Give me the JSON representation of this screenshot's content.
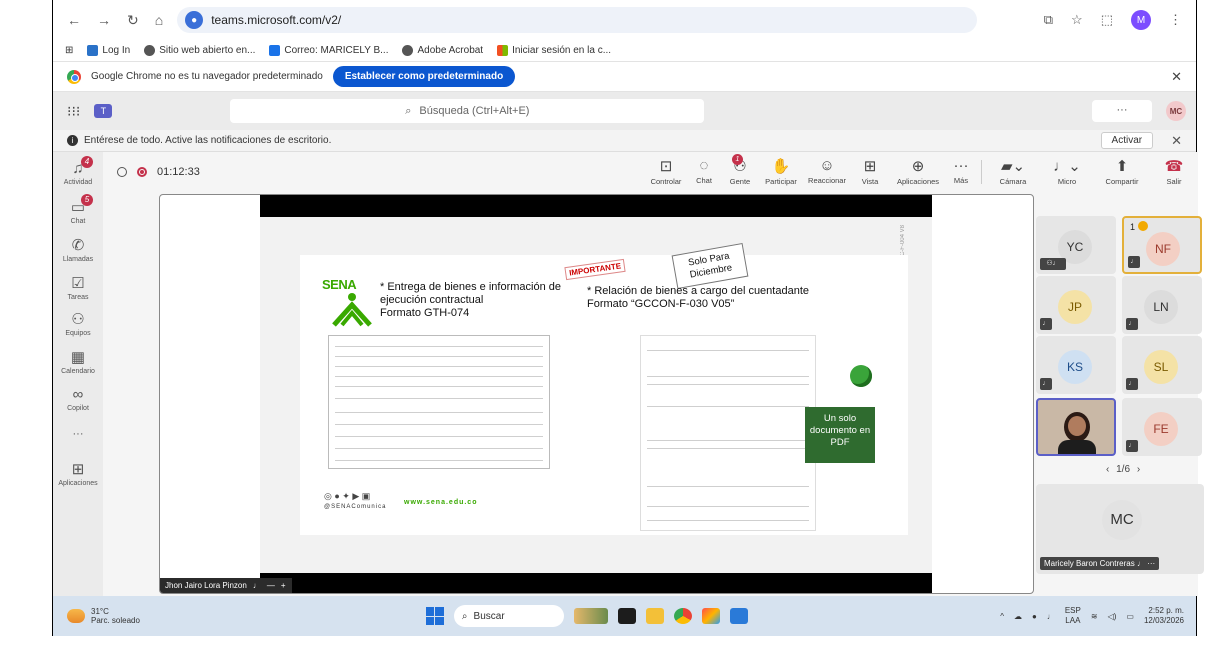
{
  "browser": {
    "url": "teams.microsoft.com/v2/",
    "profile_initial": "M",
    "bookmarks": [
      "Log In",
      "Sitio web abierto en...",
      "Correo: MARICELY B...",
      "Adobe Acrobat",
      "Iniciar sesión en la c..."
    ],
    "infobar_text": "Google Chrome no es tu navegador predeterminado",
    "infobar_button": "Establecer como predeterminado"
  },
  "teams": {
    "search_placeholder": "Búsqueda (Ctrl+Alt+E)",
    "more_label": "···",
    "user_initials": "MC",
    "notice_text": "Entérese de todo. Active las notificaciones de escritorio.",
    "notice_button": "Activar"
  },
  "rail": [
    {
      "label": "Actividad",
      "badge": "4"
    },
    {
      "label": "Chat",
      "badge": "5"
    },
    {
      "label": "Llamadas"
    },
    {
      "label": "Tareas"
    },
    {
      "label": "Equipos"
    },
    {
      "label": "Calendario"
    },
    {
      "label": "Copilot"
    },
    {
      "label": "···"
    },
    {
      "label": "Aplicaciones"
    }
  ],
  "meeting": {
    "timer": "01:12:33",
    "controls": [
      "Controlar",
      "Chat",
      "Gente",
      "Participar",
      "Reaccionar",
      "Vista",
      "Aplicaciones",
      "Más",
      "Cámara",
      "Micro",
      "Compartir",
      "Salir"
    ],
    "people_badge": "1"
  },
  "slide": {
    "sena_logo": "SENA",
    "left_title": "* Entrega de bienes e información de ejecución contractual",
    "left_format": "Formato GTH-074",
    "right_title": "* Relación de bienes a cargo del cuentadante",
    "right_format": "Formato “GCCON-F-030 V05”",
    "stamp": "IMPORTANTE",
    "note": "Solo Para Diciembre",
    "pdf_box": "Un solo documento en PDF",
    "social_handle": "@SENAComunica",
    "website": "www.sena.edu.co",
    "vertical_code": "GC-F-004 V8"
  },
  "presenter_name": "Jhon Jairo Lora Pinzon",
  "participants": [
    {
      "initials": "YC",
      "color": "#dcdcdc"
    },
    {
      "initials": "NF",
      "color": "#f3cfc4",
      "count": "1"
    },
    {
      "initials": "JP",
      "color": "#f4e2a6"
    },
    {
      "initials": "LN",
      "color": "#dcdcdc"
    },
    {
      "initials": "KS",
      "color": "#cfe0f2"
    },
    {
      "initials": "SL",
      "color": "#f4e2a6"
    },
    {
      "initials": "FE",
      "color": "#f3cfc4"
    }
  ],
  "pager": "1/6",
  "self_tile": {
    "initials": "MC",
    "name": "Maricely Baron Contreras"
  },
  "taskbar": {
    "temp": "31°C",
    "weather": "Parc. soleado",
    "search": "Buscar",
    "lang": "ESP",
    "lang2": "LAA",
    "time": "2:52 p. m.",
    "date": "12/03/2026"
  }
}
